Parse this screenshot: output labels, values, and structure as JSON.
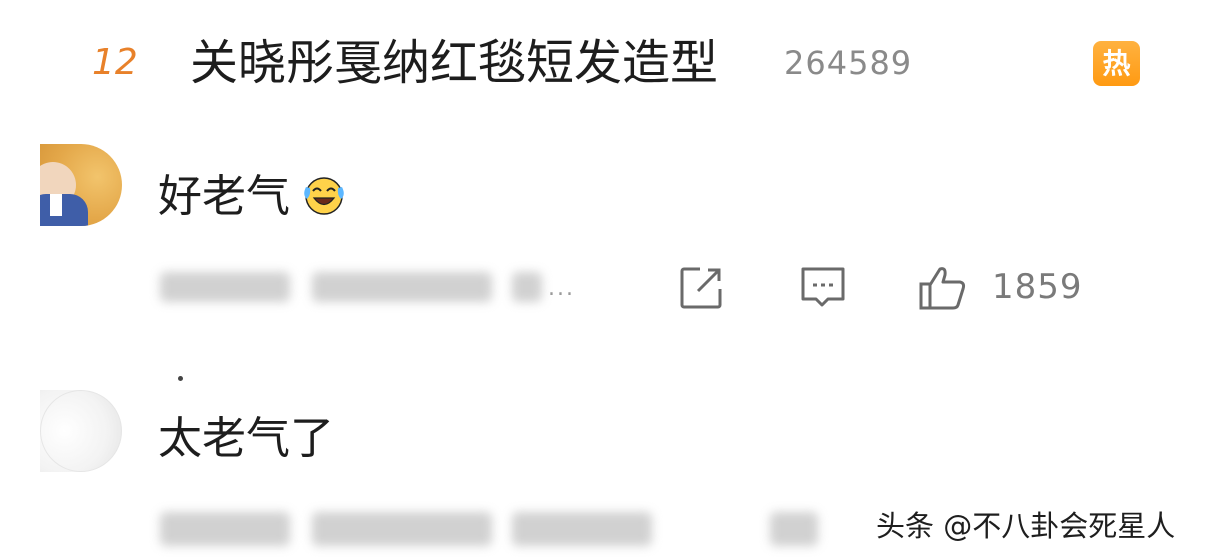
{
  "hot_search": {
    "rank": "12",
    "title": "关晓彤戛纳红毯短发造型",
    "count": "264589",
    "badge": "热"
  },
  "comments": [
    {
      "text": "好老气",
      "emoji": "laughing-crying-emoji",
      "more": "...",
      "like_count": "1859"
    },
    {
      "text": "太老气了"
    }
  ],
  "icons": {
    "share": "share-icon",
    "comment": "comment-icon",
    "like": "thumbs-up-icon"
  },
  "colors": {
    "rank": "#e8812a",
    "badge": "#ff9a12",
    "count": "#8a8a8a"
  },
  "watermark": "头条 @不八卦会死星人"
}
